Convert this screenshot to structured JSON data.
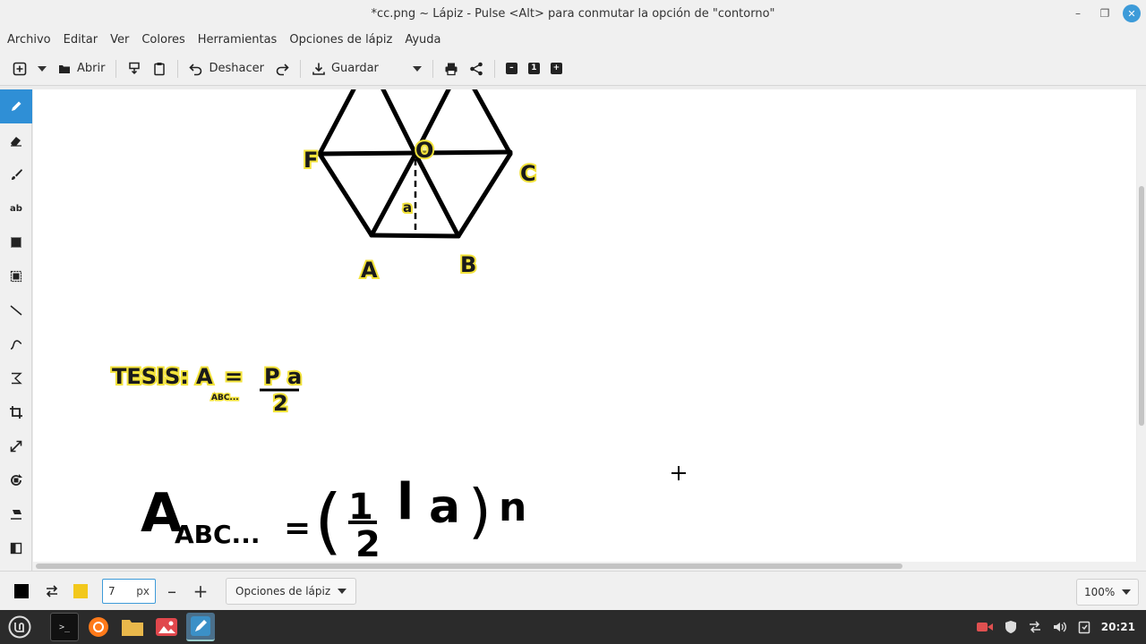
{
  "window": {
    "title": "*cc.png ~ Lápiz - Pulse <Alt> para conmutar la opción de \"contorno\""
  },
  "menu": [
    "Archivo",
    "Editar",
    "Ver",
    "Colores",
    "Herramientas",
    "Opciones de lápiz",
    "Ayuda"
  ],
  "toolbar": {
    "open_label": "Abrir",
    "undo_label": "Deshacer",
    "save_label": "Guardar",
    "zoom_one_label": "1"
  },
  "tools": [
    "pencil-icon",
    "eraser-icon",
    "brush-icon",
    "text-icon",
    "rectangle-select-icon",
    "free-select-icon",
    "line-icon",
    "curve-icon",
    "shape-icon",
    "crop-icon",
    "scale-icon",
    "rotate-icon",
    "skew-icon",
    "filters-icon"
  ],
  "tools_text": {
    "text_tool": "ab"
  },
  "canvas": {
    "label_F": "F",
    "label_O": "O",
    "label_C": "C",
    "label_a": "a",
    "label_A": "A",
    "label_B": "B",
    "thesis_prefix": "TESIS:",
    "thesis_A": "A",
    "thesis_eq": "=",
    "thesis_sub": "ABC...",
    "thesis_num": "P a",
    "thesis_den": "2",
    "hand_A": "A",
    "hand_sub": "ABC...",
    "hand_eq": "=",
    "hand_open": "(",
    "hand_num": "1",
    "hand_den": "2",
    "hand_l": "l",
    "hand_a": "a",
    "hand_close": ")",
    "hand_n": "n"
  },
  "bottombar": {
    "size_value": "7",
    "size_unit": "px",
    "options_label": "Opciones de lápiz",
    "zoom": "100%",
    "primary_color": "#000000",
    "secondary_color": "#f2c81c"
  },
  "taskbar": {
    "clock": "20:21"
  },
  "colors": {
    "accent": "#2f8fd6",
    "highlight": "#f2e23a"
  }
}
